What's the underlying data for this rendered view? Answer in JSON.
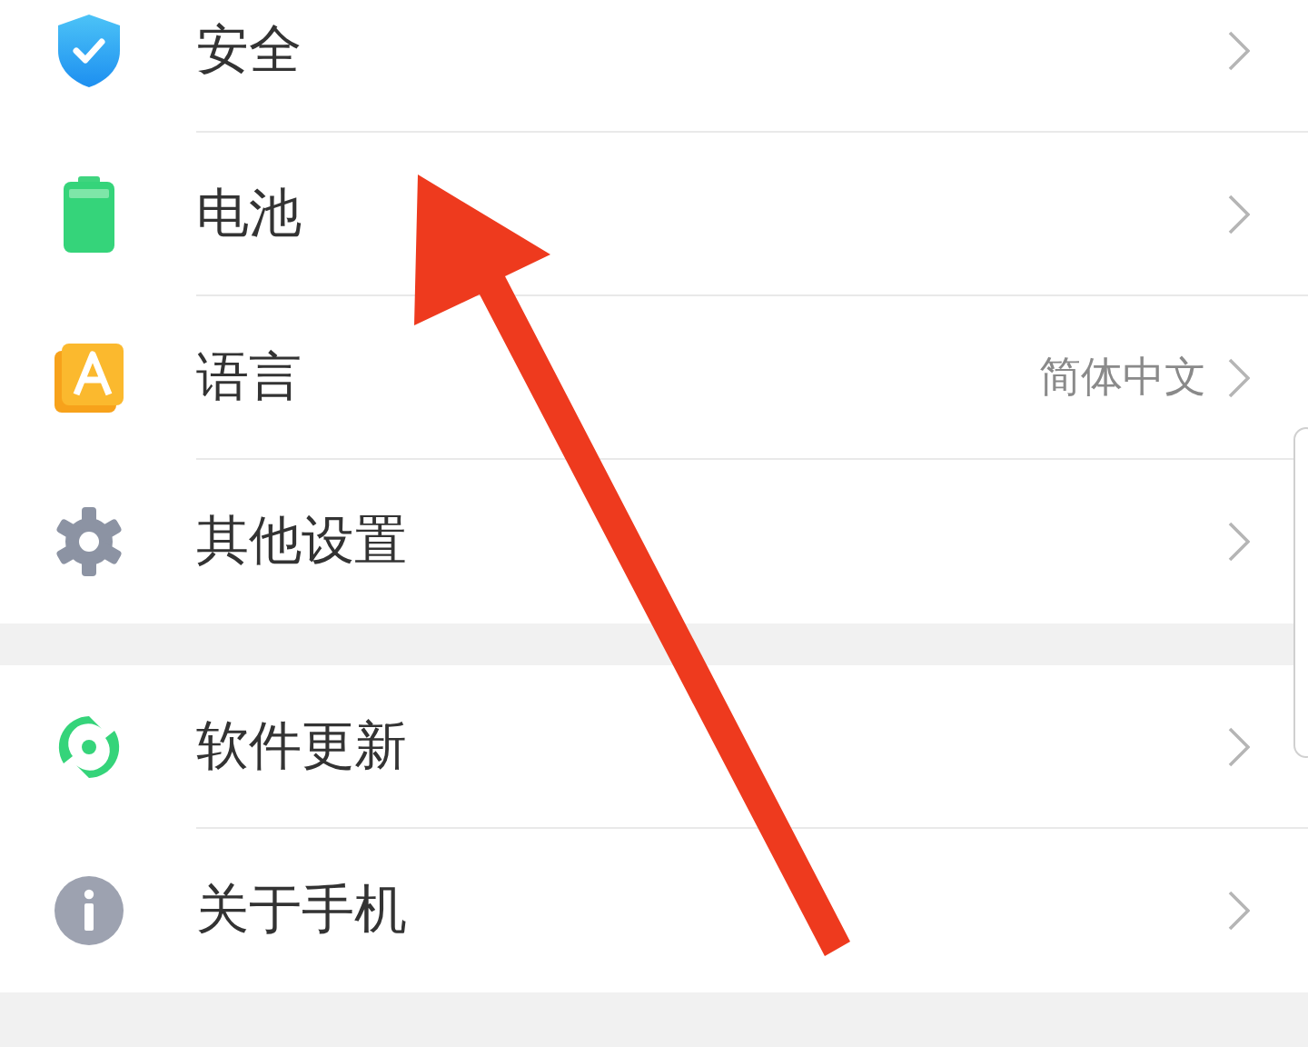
{
  "groups": [
    {
      "items": [
        {
          "kind": "shield",
          "label": "安全"
        },
        {
          "kind": "battery",
          "label": "电池"
        },
        {
          "kind": "language",
          "label": "语言",
          "value": "简体中文"
        },
        {
          "kind": "gear",
          "label": "其他设置"
        }
      ]
    },
    {
      "items": [
        {
          "kind": "update",
          "label": "软件更新"
        },
        {
          "kind": "info",
          "label": "关于手机"
        }
      ]
    }
  ],
  "annotation": {
    "kind": "arrow"
  }
}
